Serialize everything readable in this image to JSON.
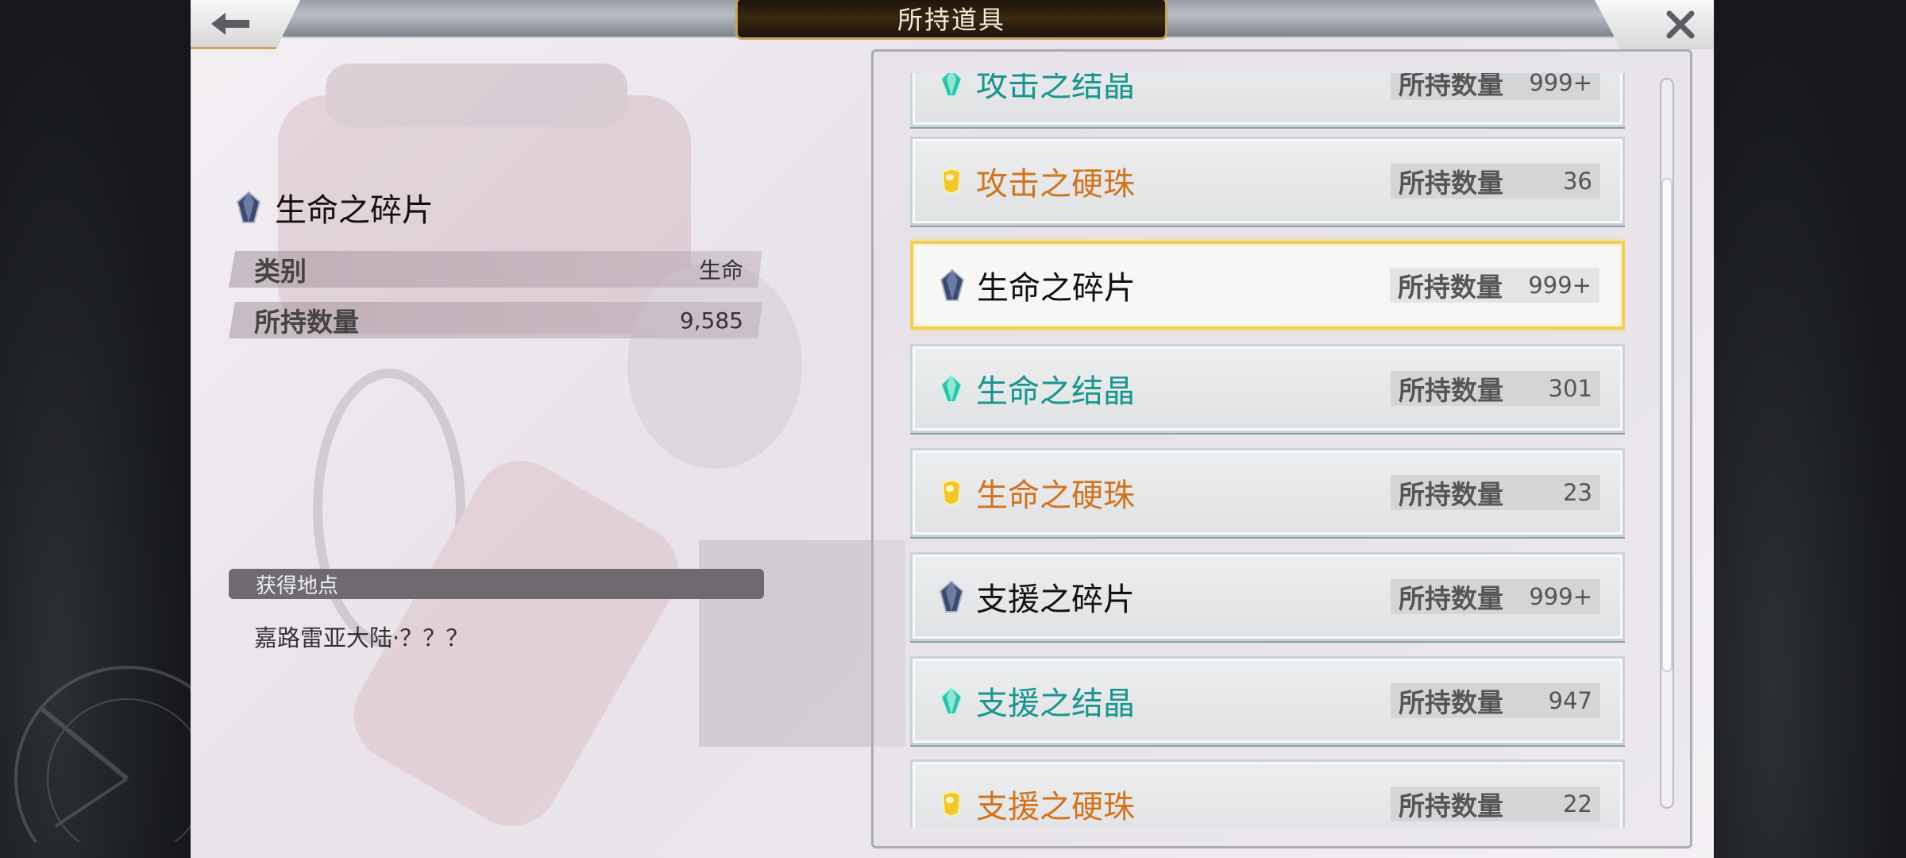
{
  "header": {
    "title": "所持道具"
  },
  "detail": {
    "item_name": "生命之碎片",
    "rows": [
      {
        "label": "类别",
        "value": "生命"
      },
      {
        "label": "所持数量",
        "value": "9,585"
      }
    ],
    "source_header": "获得地点",
    "source_text": "嘉路雷亚大陆·？？？"
  },
  "list": {
    "qty_label": "所持数量",
    "items": [
      {
        "name": "攻击之结晶",
        "qty": "999+",
        "color": "#18958f",
        "gem": "teal"
      },
      {
        "name": "攻击之硬珠",
        "qty": "36",
        "color": "#d2741d",
        "gem": "gold"
      },
      {
        "name": "生命之碎片",
        "qty": "999+",
        "color": "#111111",
        "gem": "navy",
        "selected": true
      },
      {
        "name": "生命之结晶",
        "qty": "301",
        "color": "#18958f",
        "gem": "teal"
      },
      {
        "name": "生命之硬珠",
        "qty": "23",
        "color": "#d2741d",
        "gem": "gold"
      },
      {
        "name": "支援之碎片",
        "qty": "999+",
        "color": "#111111",
        "gem": "navy"
      },
      {
        "name": "支援之结晶",
        "qty": "947",
        "color": "#18958f",
        "gem": "teal"
      },
      {
        "name": "支援之硬珠",
        "qty": "22",
        "color": "#d2741d",
        "gem": "gold"
      }
    ]
  },
  "icons": {
    "back": "arrow-left-icon",
    "close": "close-icon"
  }
}
